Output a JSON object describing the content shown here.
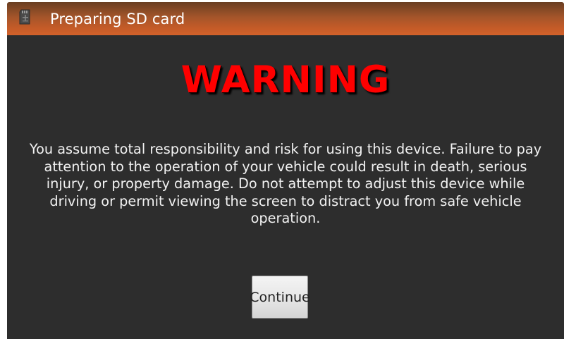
{
  "titlebar": {
    "icon": "sd-card-icon",
    "title": "Preparing SD card"
  },
  "dialog": {
    "heading": "WARNING",
    "message": "You assume total responsibility and risk for using this device. Failure to pay attention to the operation of your vehicle could result in death, serious injury, or property damage. Do not attempt to adjust this device while driving or permit viewing the screen to distract you from safe vehicle operation.",
    "continue_label": "Continue"
  },
  "colors": {
    "heading": "#ff0000",
    "dialog_background": "#2d2d2d",
    "titlebar_accent": "#c25a28"
  }
}
